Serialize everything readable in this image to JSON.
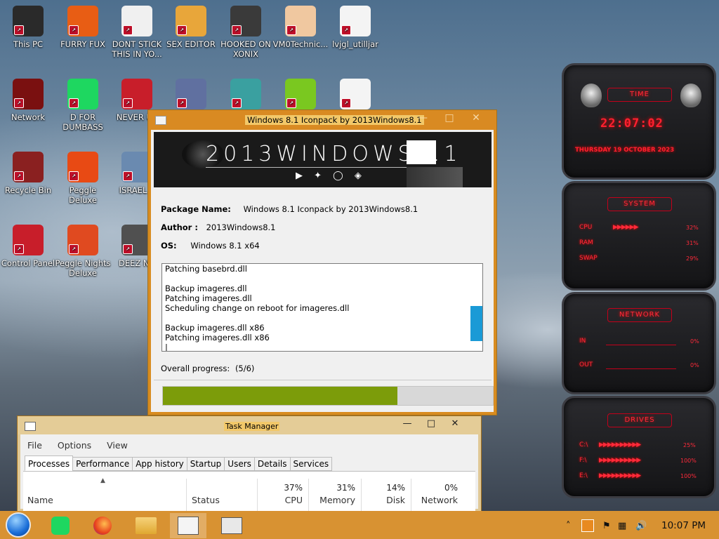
{
  "desktop_icons": [
    {
      "label": "This PC",
      "color": "#2a2a2a"
    },
    {
      "label": "FURRY FUX",
      "color": "#e85d14"
    },
    {
      "label": "DONT STICK THIS IN YO...",
      "color": "#f0f0f0"
    },
    {
      "label": "SEX EDITOR",
      "color": "#e8a63a"
    },
    {
      "label": "HOOKED ON XONIX",
      "color": "#3a3a3a"
    },
    {
      "label": "VM0Technic...",
      "color": "#f0c8a0"
    },
    {
      "label": "lvjgl_utilljar",
      "color": "#f4f4f4"
    },
    {
      "label": "Network",
      "color": "#7a1010"
    },
    {
      "label": "D FOR DUMBASS",
      "color": "#1ed760"
    },
    {
      "label": "NEVER US",
      "color": "#c81e2a"
    },
    {
      "label": "",
      "color": "#6070a0"
    },
    {
      "label": "",
      "color": "#3aa0a0"
    },
    {
      "label": "",
      "color": "#7ac820"
    },
    {
      "label": "",
      "color": "#f4f4f4"
    },
    {
      "label": "Recycle Bin",
      "color": "#8a2020"
    },
    {
      "label": "Peggle Deluxe",
      "color": "#e84a14"
    },
    {
      "label": "ISRAEL S",
      "color": "#6a8ab0"
    },
    {
      "label": "Control Panel",
      "color": "#c81e2a"
    },
    {
      "label": "Peggle Nights Deluxe",
      "color": "#e04a20"
    },
    {
      "label": "DEEZ NU",
      "color": "#505050"
    }
  ],
  "installer": {
    "title": "Windows 8.1 Iconpack by 2013Windows8.1",
    "banner_text": "2013WINDOWS8.1",
    "package_label": "Package Name:",
    "package_value": "Windows 8.1 Iconpack by 2013Windows8.1",
    "author_label": "Author :",
    "author_value": "2013Windows8.1",
    "os_label": "OS:",
    "os_value": "Windows 8.1 x64",
    "log_lines": [
      "Patching basebrd.dll",
      "",
      "Backup imageres.dll",
      "Patching imageres.dll",
      "Scheduling change on reboot for imageres.dll",
      "",
      "Backup imageres.dll x86",
      "Patching imageres.dll x86",
      "|"
    ],
    "overall_label": "Overall progress:",
    "overall_value": "(5/6)",
    "progress_fraction": 0.71
  },
  "task_manager": {
    "title": "Task Manager",
    "menu": [
      "File",
      "Options",
      "View"
    ],
    "tabs": [
      "Processes",
      "Performance",
      "App history",
      "Startup",
      "Users",
      "Details",
      "Services"
    ],
    "columns": {
      "name": "Name",
      "status": "Status",
      "cpu_label": "CPU",
      "cpu_pct": "37%",
      "memory_label": "Memory",
      "memory_pct": "31%",
      "disk_label": "Disk",
      "disk_pct": "14%",
      "network_label": "Network",
      "network_pct": "0%"
    }
  },
  "gadget": {
    "time_title": "TIME",
    "clock": "22:07:02",
    "date": "THURSDAY 19 OCTOBER 2023",
    "system_title": "SYSTEM",
    "cpu_label": "CPU",
    "cpu_value": "32%",
    "ram_label": "RAM",
    "ram_value": "31%",
    "swap_label": "SWAP",
    "swap_value": "29%",
    "network_title": "NETWORK",
    "in_label": "IN",
    "in_value": "0%",
    "out_label": "OUT",
    "out_value": "0%",
    "drives_title": "DRIVES",
    "c_label": "C:\\",
    "c_value": "25%",
    "f_label": "F:\\",
    "f_value": "100%",
    "e_label": "E:\\",
    "e_value": "100%"
  },
  "taskbar": {
    "clock": "10:07 PM"
  }
}
